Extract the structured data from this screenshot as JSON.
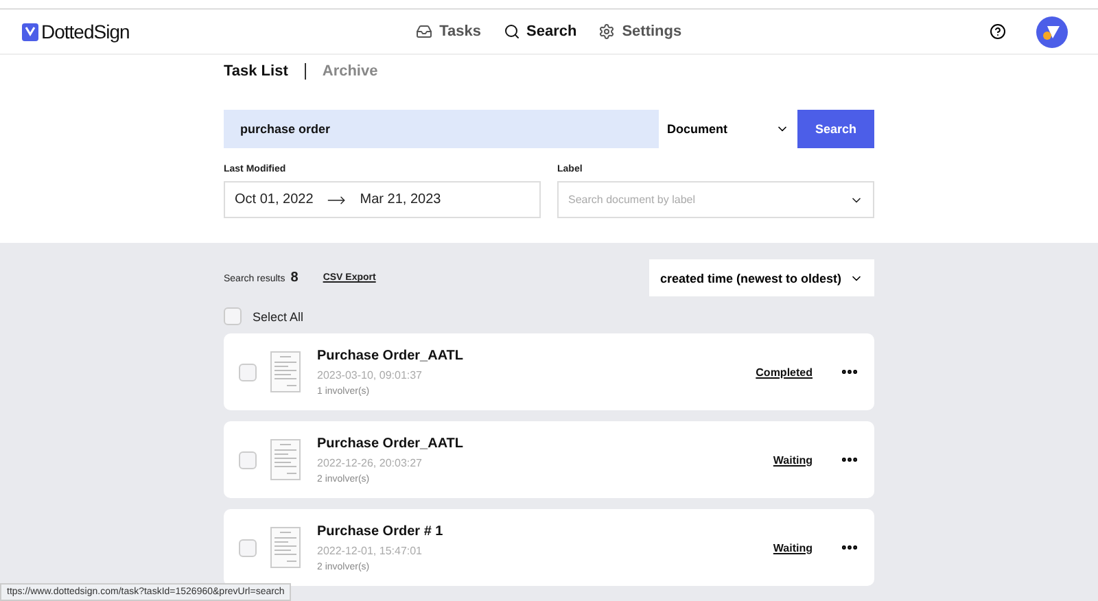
{
  "brand": {
    "name_light": "Dotted",
    "name_bold": "Sign"
  },
  "nav": [
    {
      "label": "Tasks",
      "selected": false
    },
    {
      "label": "Search",
      "selected": true
    },
    {
      "label": "Settings",
      "selected": false
    }
  ],
  "subtabs": [
    {
      "label": "Task List",
      "selected": true
    },
    {
      "label": "Archive",
      "selected": false
    }
  ],
  "search": {
    "value": "purchase order",
    "scope": "Document",
    "button": "Search"
  },
  "filters": {
    "date_label": "Last Modified",
    "date_from": "Oct 01, 2022",
    "date_to": "Mar 21, 2023",
    "label_label": "Label",
    "label_placeholder": "Search document by label"
  },
  "results": {
    "caption": "Search results",
    "count": "8",
    "export": "CSV Export",
    "sort": "created time (newest to oldest)",
    "select_all": {
      "label": "Select All",
      "checked": false
    }
  },
  "tasks": [
    {
      "title": "Purchase Order_AATL",
      "time": "2023-03-10, 09:01:37",
      "involvers": "1 involver(s)",
      "status": "Completed",
      "checked": false
    },
    {
      "title": "Purchase Order_AATL",
      "time": "2022-12-26, 20:03:27",
      "involvers": "2 involver(s)",
      "status": "Waiting",
      "checked": false
    },
    {
      "title": "Purchase Order # 1",
      "time": "2022-12-01, 15:47:01",
      "involvers": "2 involver(s)",
      "status": "Waiting",
      "checked": false
    }
  ],
  "status_bar": "ttps://www.dottedsign.com/task?taskId=1526960&prevUrl=search"
}
